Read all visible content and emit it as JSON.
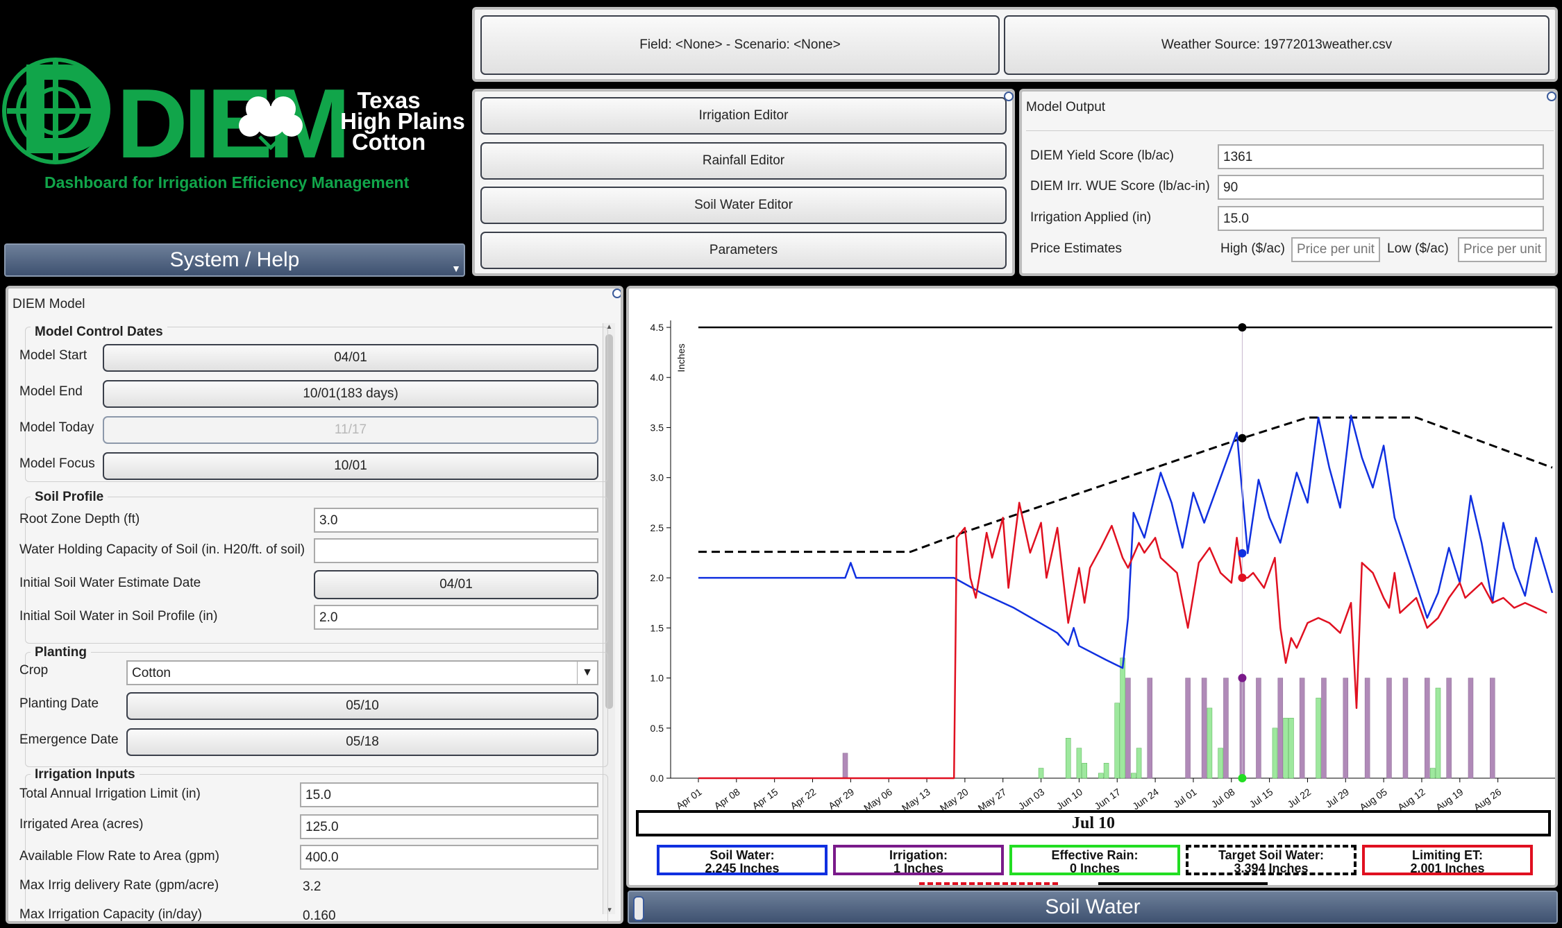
{
  "logo": {
    "wordmark": "DIEM",
    "brand_line1": "Texas",
    "brand_line2": "High Plains",
    "brand_line3": "Cotton",
    "tagline": "Dashboard for Irrigation Efficiency Management",
    "brand_color": "#11a54a"
  },
  "system_help": {
    "label": "System / Help"
  },
  "header": {
    "field_scenario": "Field: <None> - Scenario: <None>",
    "weather_source": "Weather Source: 19772013weather.csv"
  },
  "editors": {
    "irrigation": "Irrigation Editor",
    "rainfall": "Rainfall Editor",
    "soil_water": "Soil Water Editor",
    "parameters": "Parameters"
  },
  "model_output": {
    "title": "Model Output",
    "yield_label": "DIEM Yield Score (lb/ac)",
    "yield_value": "1361",
    "wue_label": "DIEM Irr. WUE Score (lb/ac-in)",
    "wue_value": "90",
    "irrigation_label": "Irrigation Applied (in)",
    "irrigation_value": "15.0",
    "price_label": "Price Estimates",
    "high_label": "High ($/ac)",
    "high_placeholder": "Price per unit",
    "low_label": "Low ($/ac)",
    "low_placeholder": "Price per unit"
  },
  "diem_model": {
    "title": "DIEM Model",
    "control_dates": {
      "title": "Model Control Dates",
      "start_label": "Model Start",
      "start_value": "04/01",
      "end_label": "Model End",
      "end_value": "10/01(183 days)",
      "today_label": "Model Today",
      "today_value": "11/17",
      "focus_label": "Model Focus",
      "focus_value": "10/01"
    },
    "soil_profile": {
      "title": "Soil Profile",
      "root_label": "Root Zone Depth (ft)",
      "root_value": "3.0",
      "whc_label": "Water Holding Capacity of Soil (in. H20/ft. of soil)",
      "whc_value": "",
      "init_date_label": "Initial Soil Water Estimate Date",
      "init_date_value": "04/01",
      "init_water_label": "Initial Soil Water in Soil Profile (in)",
      "init_water_value": "2.0"
    },
    "planting": {
      "title": "Planting",
      "crop_label": "Crop",
      "crop_value": "Cotton",
      "planting_label": "Planting Date",
      "planting_value": "05/10",
      "emergence_label": "Emergence Date",
      "emergence_value": "05/18"
    },
    "irrigation_inputs": {
      "title": "Irrigation Inputs",
      "limit_label": "Total Annual Irrigation Limit (in)",
      "limit_value": "15.0",
      "area_label": "Irrigated Area (acres)",
      "area_value": "125.0",
      "flow_label": "Available Flow Rate to Area (gpm)",
      "flow_value": "400.0",
      "max_rate_label": "Max Irrig delivery Rate (gpm/acre)",
      "max_rate_value": "3.2",
      "capacity_label": "Max Irrigation Capacity (in/day)",
      "capacity_value": "0.160"
    }
  },
  "chart_bottom": {
    "focus_date": "Jul 10",
    "soil_water_label": "Soil Water:",
    "soil_water_value": "2.245 Inches",
    "irrigation_label": "Irrigation:",
    "irrigation_value": "1 Inches",
    "rain_label": "Effective Rain:",
    "rain_value": "0 Inches",
    "target_label": "Target Soil Water:",
    "target_value": "3.394 Inches",
    "et_label": "Limiting ET:",
    "et_value": "2.001 Inches",
    "view_label": "Soil Water"
  },
  "colors": {
    "soil_water": "#1030e0",
    "irrigation": "#7a1a8a",
    "irrigation_bar": "#b08ab8",
    "rain": "#22dd22",
    "rain_bar": "#9ee89e",
    "target": "#000000",
    "et": "#e01020"
  },
  "chart_data": {
    "type": "line",
    "ylabel": "Inches",
    "ylim": [
      0,
      4.5
    ],
    "yticks": [
      "0.0",
      "0.5",
      "1.0",
      "1.5",
      "2.0",
      "2.5",
      "3.0",
      "3.5",
      "4.0",
      "4.5"
    ],
    "x_domain": [
      0,
      157
    ],
    "x_ticks": [
      {
        "d": 0,
        "label": "Apr 01"
      },
      {
        "d": 7,
        "label": "Apr 08"
      },
      {
        "d": 14,
        "label": "Apr 15"
      },
      {
        "d": 21,
        "label": "Apr 22"
      },
      {
        "d": 28,
        "label": "Apr 29"
      },
      {
        "d": 35,
        "label": "May 06"
      },
      {
        "d": 42,
        "label": "May 13"
      },
      {
        "d": 49,
        "label": "May 20"
      },
      {
        "d": 56,
        "label": "May 27"
      },
      {
        "d": 63,
        "label": "Jun 03"
      },
      {
        "d": 70,
        "label": "Jun 10"
      },
      {
        "d": 77,
        "label": "Jun 17"
      },
      {
        "d": 84,
        "label": "Jun 24"
      },
      {
        "d": 91,
        "label": "Jul 01"
      },
      {
        "d": 98,
        "label": "Jul 08"
      },
      {
        "d": 105,
        "label": "Jul 15"
      },
      {
        "d": 112,
        "label": "Jul 22"
      },
      {
        "d": 119,
        "label": "Jul 29"
      },
      {
        "d": 126,
        "label": "Aug 05"
      },
      {
        "d": 133,
        "label": "Aug 12"
      },
      {
        "d": 140,
        "label": "Aug 19"
      },
      {
        "d": 147,
        "label": "Aug 26"
      }
    ],
    "focus_day": 100,
    "series": [
      {
        "name": "Upper Limit",
        "style": "solid-black",
        "points": [
          [
            0,
            4.5
          ],
          [
            157,
            4.5
          ]
        ]
      },
      {
        "name": "Target Soil Water",
        "style": "dashed-black",
        "points": [
          [
            0,
            2.26
          ],
          [
            39,
            2.26
          ],
          [
            48,
            2.44
          ],
          [
            100,
            3.394
          ],
          [
            112,
            3.6
          ],
          [
            132,
            3.6
          ],
          [
            157,
            3.1
          ]
        ]
      },
      {
        "name": "Soil Water",
        "style": "blue",
        "points": [
          [
            0,
            2.0
          ],
          [
            27,
            2.0
          ],
          [
            28,
            2.15
          ],
          [
            29,
            2.0
          ],
          [
            47,
            2.0
          ],
          [
            52,
            1.85
          ],
          [
            58,
            1.7
          ],
          [
            66,
            1.45
          ],
          [
            68,
            1.33
          ],
          [
            69,
            1.5
          ],
          [
            70,
            1.32
          ],
          [
            75,
            1.18
          ],
          [
            78,
            1.1
          ],
          [
            79,
            1.6
          ],
          [
            80,
            2.65
          ],
          [
            82,
            2.4
          ],
          [
            85,
            3.05
          ],
          [
            87,
            2.75
          ],
          [
            89,
            2.3
          ],
          [
            91,
            2.85
          ],
          [
            93,
            2.55
          ],
          [
            96,
            3.0
          ],
          [
            99,
            3.45
          ],
          [
            101,
            2.245
          ],
          [
            103,
            2.98
          ],
          [
            105,
            2.6
          ],
          [
            107,
            2.35
          ],
          [
            110,
            3.05
          ],
          [
            112,
            2.75
          ],
          [
            114,
            3.6
          ],
          [
            116,
            3.1
          ],
          [
            118,
            2.7
          ],
          [
            120,
            3.62
          ],
          [
            122,
            3.2
          ],
          [
            124,
            2.9
          ],
          [
            126,
            3.32
          ],
          [
            128,
            2.6
          ],
          [
            131,
            2.1
          ],
          [
            134,
            1.6
          ],
          [
            136,
            1.85
          ],
          [
            138,
            2.3
          ],
          [
            140,
            1.95
          ],
          [
            142,
            2.82
          ],
          [
            144,
            2.35
          ],
          [
            146,
            1.75
          ],
          [
            148,
            2.55
          ],
          [
            150,
            2.1
          ],
          [
            152,
            1.82
          ],
          [
            154,
            2.4
          ],
          [
            157,
            1.85
          ]
        ]
      },
      {
        "name": "Limiting ET",
        "style": "red",
        "points": [
          [
            0,
            0
          ],
          [
            47,
            0
          ],
          [
            47.5,
            2.4
          ],
          [
            49,
            2.5
          ],
          [
            50,
            2.0
          ],
          [
            51,
            1.8
          ],
          [
            53,
            2.45
          ],
          [
            54,
            2.2
          ],
          [
            56,
            2.6
          ],
          [
            57,
            1.9
          ],
          [
            59,
            2.75
          ],
          [
            61,
            2.25
          ],
          [
            63,
            2.55
          ],
          [
            64,
            2.0
          ],
          [
            66,
            2.5
          ],
          [
            68,
            1.55
          ],
          [
            70,
            2.1
          ],
          [
            71,
            1.75
          ],
          [
            72,
            2.1
          ],
          [
            74,
            2.3
          ],
          [
            76,
            2.52
          ],
          [
            78,
            2.2
          ],
          [
            79,
            2.1
          ],
          [
            81,
            2.35
          ],
          [
            82,
            2.25
          ],
          [
            84,
            2.4
          ],
          [
            85,
            2.2
          ],
          [
            88,
            2.05
          ],
          [
            90,
            1.5
          ],
          [
            92,
            2.15
          ],
          [
            94,
            2.3
          ],
          [
            96,
            2.05
          ],
          [
            98,
            1.95
          ],
          [
            99,
            2.4
          ],
          [
            100,
            2.0
          ],
          [
            101,
            2.001
          ],
          [
            102,
            2.05
          ],
          [
            104,
            1.9
          ],
          [
            106,
            2.2
          ],
          [
            107,
            1.5
          ],
          [
            108,
            1.15
          ],
          [
            109,
            1.4
          ],
          [
            110,
            1.3
          ],
          [
            112,
            1.55
          ],
          [
            114,
            1.6
          ],
          [
            116,
            1.55
          ],
          [
            118,
            1.45
          ],
          [
            120,
            1.75
          ],
          [
            121,
            0.7
          ],
          [
            122,
            2.15
          ],
          [
            124,
            2.05
          ],
          [
            126,
            1.8
          ],
          [
            127,
            1.7
          ],
          [
            128,
            2.05
          ],
          [
            129,
            1.65
          ],
          [
            132,
            1.8
          ],
          [
            134,
            1.5
          ],
          [
            136,
            1.6
          ],
          [
            138,
            1.8
          ],
          [
            140,
            1.95
          ],
          [
            141,
            1.8
          ],
          [
            144,
            1.95
          ],
          [
            146,
            1.75
          ],
          [
            148,
            1.8
          ],
          [
            150,
            1.7
          ],
          [
            152,
            1.75
          ],
          [
            154,
            1.7
          ],
          [
            156,
            1.65
          ]
        ]
      }
    ],
    "irrigation_bars": [
      [
        27,
        0.25
      ],
      [
        79,
        1.0
      ],
      [
        83,
        1.0
      ],
      [
        90,
        1.0
      ],
      [
        93,
        1.0
      ],
      [
        97,
        1.0
      ],
      [
        100,
        1.0
      ],
      [
        103,
        1.0
      ],
      [
        107,
        1.0
      ],
      [
        111,
        1.0
      ],
      [
        115,
        1.0
      ],
      [
        119,
        1.0
      ],
      [
        123,
        1.0
      ],
      [
        127,
        1.0
      ],
      [
        130,
        1.0
      ],
      [
        134,
        1.0
      ],
      [
        138,
        1.0
      ],
      [
        142,
        1.0
      ],
      [
        146,
        1.0
      ]
    ],
    "rain_bars": [
      [
        63,
        0.1
      ],
      [
        68,
        0.4
      ],
      [
        70,
        0.3
      ],
      [
        71,
        0.15
      ],
      [
        74,
        0.05
      ],
      [
        75,
        0.15
      ],
      [
        77,
        0.75
      ],
      [
        78,
        1.2
      ],
      [
        80,
        0.05
      ],
      [
        81,
        0.3
      ],
      [
        94,
        0.7
      ],
      [
        96,
        0.3
      ],
      [
        106,
        0.5
      ],
      [
        108,
        0.6
      ],
      [
        109,
        0.6
      ],
      [
        114,
        0.8
      ],
      [
        135,
        0.1
      ],
      [
        136,
        0.9
      ]
    ],
    "focus_markers": [
      {
        "name": "Upper Limit",
        "value": 4.5
      },
      {
        "name": "Target Soil Water",
        "value": 3.394
      },
      {
        "name": "Soil Water",
        "value": 2.245
      },
      {
        "name": "Limiting ET",
        "value": 2.001
      },
      {
        "name": "Irrigation",
        "value": 1.0
      },
      {
        "name": "Effective Rain",
        "value": 0.0
      }
    ]
  }
}
